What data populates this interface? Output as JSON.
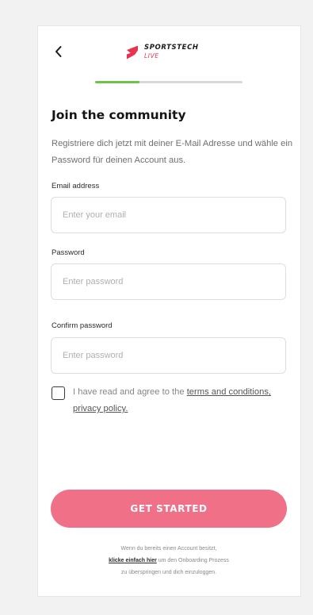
{
  "header": {
    "back_icon": "chevron-left-icon",
    "logo": {
      "brand": "SPORTSTECH",
      "sub": "LIVE",
      "brand_color": "#e6334f"
    }
  },
  "progress": {
    "value": 0.3,
    "fill_color": "#6dc24b",
    "track_color": "#d9d9d9"
  },
  "title": "Join the community",
  "subtitle": "Registriere dich jetzt mit deiner E-Mail Adresse und wähle ein Password für deinen Account aus.",
  "form": {
    "email": {
      "label": "Email address",
      "placeholder": "Enter your email",
      "value": ""
    },
    "password": {
      "label": "Password",
      "placeholder": "Enter password",
      "value": ""
    },
    "confirm": {
      "label": "Confirm password",
      "placeholder": "Enter password",
      "value": ""
    }
  },
  "terms": {
    "checked": false,
    "prefix": "I have read and agree to the ",
    "link": "terms and conditions, privacy policy."
  },
  "cta": {
    "label": "GET STARTED",
    "color": "#ef7087"
  },
  "footer": {
    "line1": "Wenn du bereits einen Account besitzt,",
    "link": "klicke einfach hier",
    "line2_rest": " um den Onboarding Prozess",
    "line3": "zu überspringen und dich einzuloggen."
  }
}
